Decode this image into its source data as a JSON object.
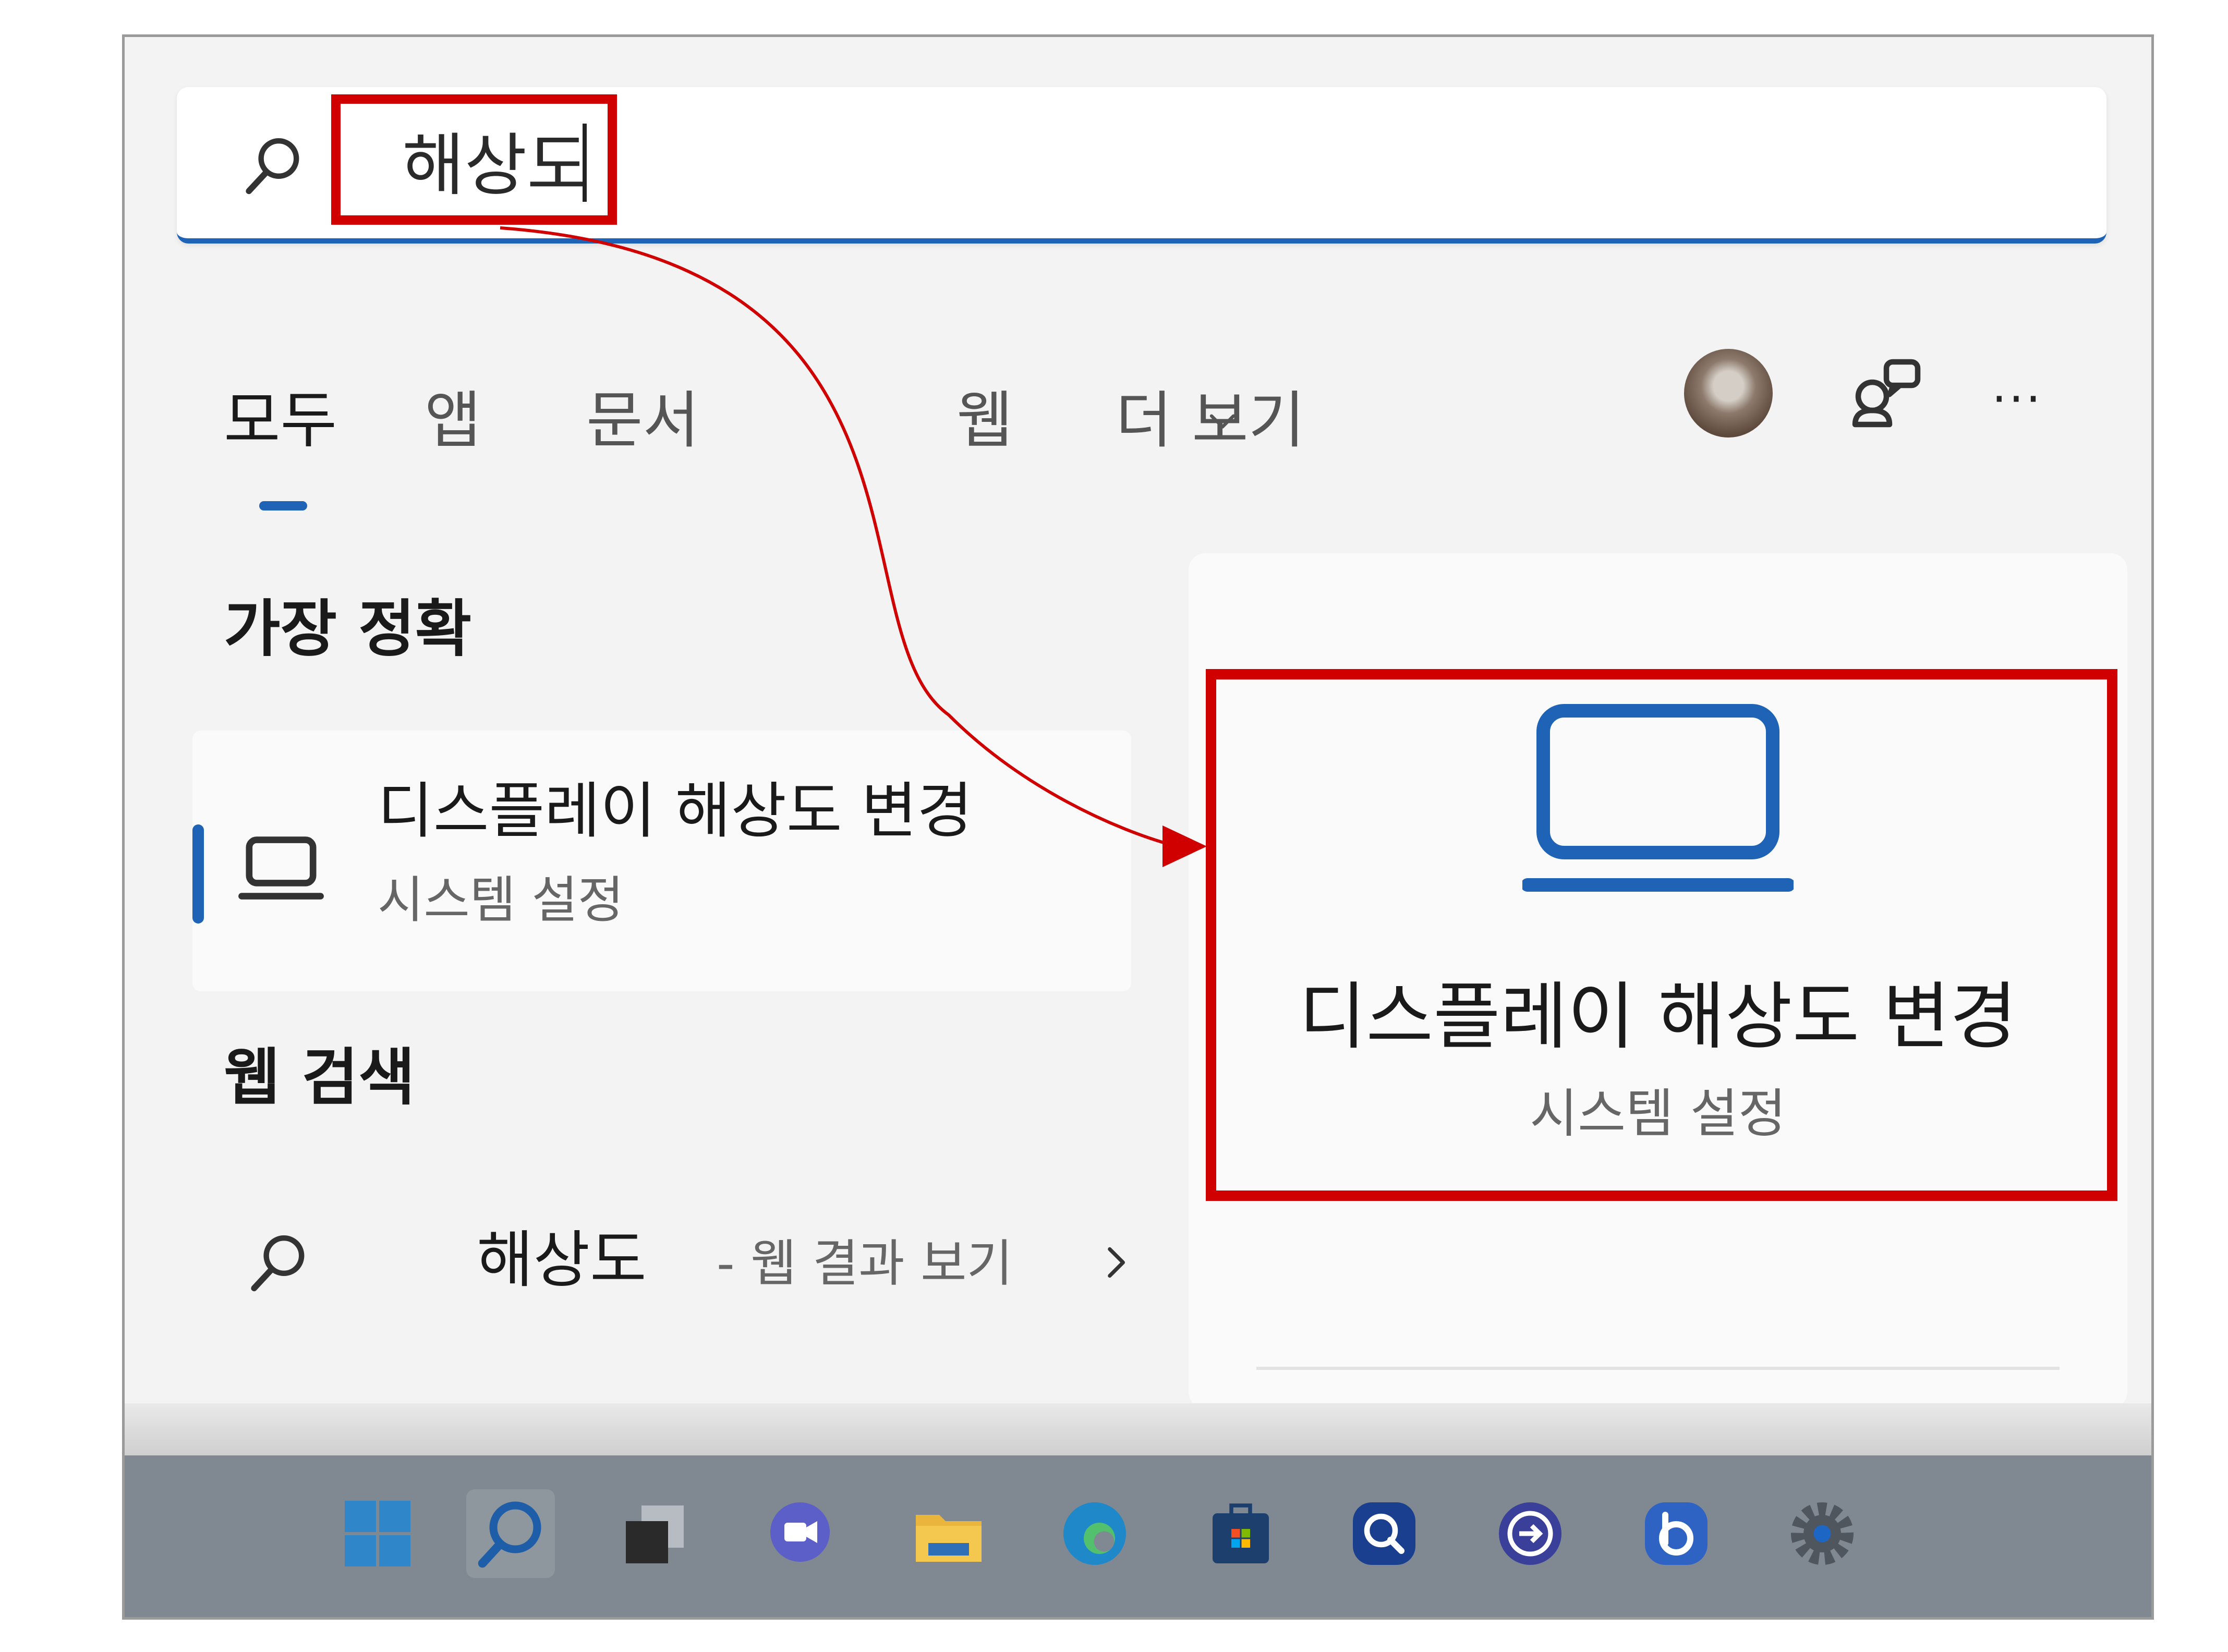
{
  "search": {
    "value": "해상도"
  },
  "tabs": [
    "모두",
    "앱",
    "문서",
    "웹",
    "더 보기"
  ],
  "sections": {
    "best_match": "가장 정확",
    "web_search": "웹 검색"
  },
  "best_match": {
    "title": "디스플레이 해상도 변경",
    "subtitle": "시스템 설정"
  },
  "web_result": {
    "query": "해상도",
    "suffix": "- 웹 결과 보기"
  },
  "detail": {
    "title": "디스플레이 해상도 변경",
    "subtitle": "시스템 설정"
  },
  "header_actions": {
    "more": "···"
  },
  "taskbar": [
    "windows-start",
    "search",
    "task-view",
    "chat",
    "file-explorer",
    "edge",
    "store",
    "quick-assist",
    "switch-app",
    "bing",
    "settings"
  ],
  "colors": {
    "accent": "#1f63b6",
    "highlight": "#d10000",
    "panel_bg": "#f3f3f3",
    "taskbar_bg": "#808891"
  }
}
